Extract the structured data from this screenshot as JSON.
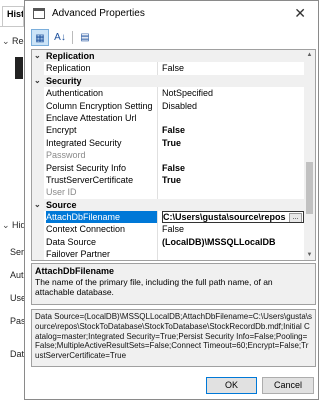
{
  "background": {
    "tab_label": "Histo",
    "section1_label": "Rec",
    "section2_label": "Hide",
    "labels": [
      "Ser",
      "Aut",
      "Use",
      "Pas",
      "Dat"
    ]
  },
  "dialog": {
    "title": "Advanced Properties",
    "toolbar": {
      "categorized_icon": "categorized-icon",
      "alphabetical_icon": "alphabetical-icon",
      "property_pages_icon": "property-pages-icon"
    },
    "grid": {
      "rows": [
        {
          "type": "category",
          "name": "Replication"
        },
        {
          "type": "prop",
          "name": "Replication",
          "value": "False"
        },
        {
          "type": "category",
          "name": "Security"
        },
        {
          "type": "prop",
          "name": "Authentication",
          "value": "NotSpecified"
        },
        {
          "type": "prop",
          "name": "Column Encryption Setting",
          "value": "Disabled"
        },
        {
          "type": "prop",
          "name": "Enclave Attestation Url",
          "value": ""
        },
        {
          "type": "prop",
          "name": "Encrypt",
          "value": "False",
          "bold": true
        },
        {
          "type": "prop",
          "name": "Integrated Security",
          "value": "True",
          "bold": true
        },
        {
          "type": "prop",
          "name": "Password",
          "value": "",
          "dim": true
        },
        {
          "type": "prop",
          "name": "Persist Security Info",
          "value": "False",
          "bold": true
        },
        {
          "type": "prop",
          "name": "TrustServerCertificate",
          "value": "True",
          "bold": true
        },
        {
          "type": "prop",
          "name": "User ID",
          "value": "",
          "dim": true
        },
        {
          "type": "category",
          "name": "Source"
        },
        {
          "type": "prop",
          "name": "AttachDbFilename",
          "value": "C:\\Users\\gusta\\source\\repos",
          "selected": true,
          "button": "..."
        },
        {
          "type": "prop",
          "name": "Context Connection",
          "value": "False"
        },
        {
          "type": "prop",
          "name": "Data Source",
          "value": "(LocalDB)\\MSSQLLocalDB",
          "bold": true
        },
        {
          "type": "prop",
          "name": "Failover Partner",
          "value": ""
        }
      ]
    },
    "description": {
      "title": "AttachDbFilename",
      "text": "The name of the primary file, including the full path name, of an attachable database."
    },
    "connection_string": "Data Source=(LocalDB)\\MSSQLLocalDB;AttachDbFilename=C:\\Users\\gusta\\source\\repos\\StockToDatabase\\StockToDatabase\\StockRecordDb.mdf;Initial Catalog=master;Integrated Security=True;Persist Security Info=False;Pooling=False;MultipleActiveResultSets=False;Connect Timeout=60;Encrypt=False;TrustServerCertificate=True",
    "ok_label": "OK",
    "cancel_label": "Cancel"
  }
}
